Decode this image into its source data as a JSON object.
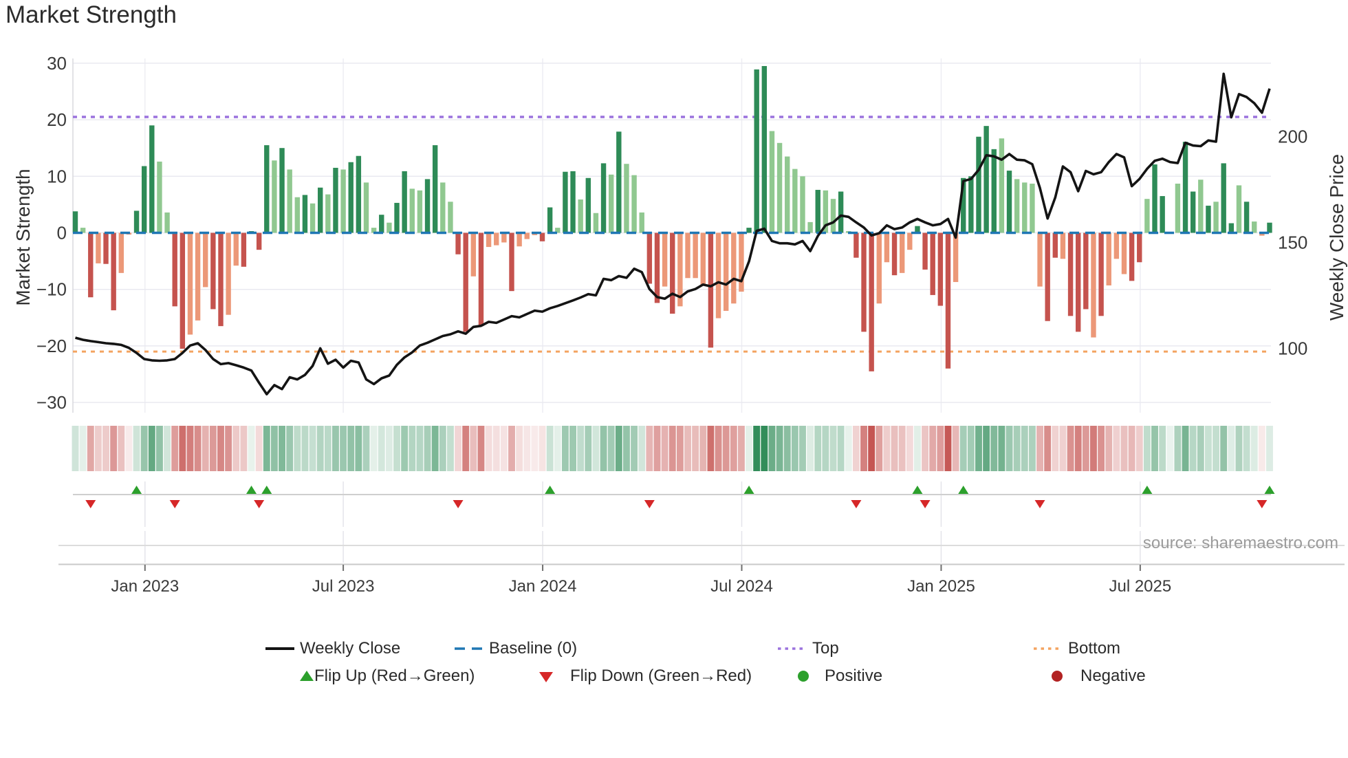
{
  "title": "Market Strength",
  "source": "source: sharemaestro.com",
  "axes": {
    "left": {
      "label": "Market Strength",
      "ticks": [
        30,
        20,
        10,
        0,
        -10,
        -20,
        -30
      ]
    },
    "right": {
      "label": "Weekly Close Price",
      "ticks": [
        200,
        150,
        100
      ]
    },
    "x": {
      "tick_labels": [
        "Jan 2023",
        "Jul 2023",
        "Jan 2024",
        "Jul 2024",
        "Jan 2025",
        "Jul 2025"
      ],
      "tick_week_index": [
        9.1,
        35.0,
        61.05,
        87.05,
        113.1,
        139.1
      ]
    }
  },
  "colors": {
    "dark_green": "#2e8b57",
    "light_green": "#90c890",
    "dark_red": "#c5534e",
    "light_red": "#ec9878",
    "baseline": "#1f77b4",
    "top": "#9b72dd",
    "bottom": "#f4a460",
    "line": "#141414",
    "flip_up": "#2ca02c",
    "flip_down": "#d62728",
    "positive": "#2ca02c",
    "negative": "#b22222",
    "grid": "#e9e9f0"
  },
  "legend": {
    "row1": [
      {
        "label": "Weekly Close",
        "swatch": "line",
        "color_key": "line"
      },
      {
        "label": "Baseline (0)",
        "swatch": "dash",
        "color_key": "baseline"
      },
      {
        "label": "Top",
        "swatch": "dot",
        "color_key": "top"
      },
      {
        "label": "Bottom",
        "swatch": "dot",
        "color_key": "bottom"
      }
    ],
    "row2": [
      {
        "label": "Flip Up (Red→Green)",
        "swatch": "tri-up",
        "color_key": "flip_up"
      },
      {
        "label": "Flip Down (Green→Red)",
        "swatch": "tri-down",
        "color_key": "flip_down"
      },
      {
        "label": "Positive",
        "swatch": "circle",
        "color_key": "positive"
      },
      {
        "label": "Negative",
        "swatch": "circle",
        "color_key": "negative"
      }
    ]
  },
  "chart_data": [
    {
      "type": "bar",
      "name": "market_strength_bars",
      "title": "Market Strength",
      "ylabel": "Market Strength",
      "ylim": [
        -33,
        31.5
      ],
      "n_weeks": 157,
      "baseline": 0,
      "top_line": 20.5,
      "bottom_line": -21,
      "grid": true,
      "values": [
        3.8,
        0.9,
        -11.4,
        -5.4,
        -5.5,
        -13.7,
        -7.1,
        -0.3,
        3.9,
        11.8,
        19.0,
        12.6,
        3.6,
        -13.0,
        -20.5,
        -18.0,
        -15.5,
        -9.6,
        -13.5,
        -16.5,
        -14.5,
        -5.8,
        -6.0,
        0.3,
        -3.0,
        15.5,
        12.8,
        15.0,
        11.2,
        6.3,
        6.7,
        5.2,
        8.0,
        6.8,
        11.5,
        11.2,
        12.5,
        13.6,
        8.9,
        0.9,
        3.2,
        1.8,
        5.3,
        10.9,
        7.8,
        7.5,
        9.5,
        15.5,
        8.9,
        5.5,
        -3.8,
        -17.5,
        -7.7,
        -16.5,
        -2.5,
        -2.2,
        -1.7,
        -10.3,
        -2.4,
        -1.1,
        -0.4,
        -1.5,
        4.5,
        0.9,
        10.8,
        10.9,
        5.9,
        9.7,
        3.5,
        12.3,
        10.3,
        17.9,
        12.2,
        10.2,
        3.6,
        -9.0,
        -12.4,
        -9.5,
        -14.3,
        -13.0,
        -8.0,
        -8.0,
        -9.3,
        -20.3,
        -15.1,
        -13.8,
        -12.5,
        -10.4,
        0.9,
        28.9,
        29.5,
        18.0,
        15.9,
        13.5,
        11.3,
        10.0,
        1.9,
        7.6,
        7.5,
        6.0,
        7.3,
        0.3,
        -4.4,
        -17.5,
        -24.5,
        -12.5,
        -5.2,
        -7.5,
        -7.1,
        -3.0,
        1.2,
        -6.5,
        -11.0,
        -12.9,
        -24.0,
        -8.7,
        9.7,
        10.0,
        17.0,
        18.9,
        14.8,
        16.7,
        11.0,
        9.5,
        8.9,
        8.7,
        -9.5,
        -15.6,
        -4.4,
        -4.6,
        -14.7,
        -17.5,
        -13.5,
        -18.5,
        -14.7,
        -9.3,
        -4.6,
        -7.3,
        -8.5,
        -5.2,
        6.0,
        12.1,
        6.5,
        0.0,
        8.7,
        16.1,
        7.3,
        9.4,
        4.8,
        5.5,
        12.3,
        1.7,
        8.4,
        5.5,
        2.0,
        -0.5,
        1.8
      ],
      "shades": "dldlddlldddllddlllddllddddldlldldldlddlldlddllddllddldllldlllddlddldldldlllddldlllldlllldddlllllldlldldddlldlldddddldddddldllllddldddldlllddlddllddldlddldlldd"
    },
    {
      "type": "line",
      "name": "weekly_close",
      "legend_label": "Weekly Close",
      "ylabel": "Weekly Close Price",
      "yticks": [
        100,
        150,
        200
      ],
      "n_weeks": 157,
      "values": [
        105.0,
        104.0,
        103.4,
        102.9,
        102.4,
        102.1,
        101.6,
        100.2,
        97.8,
        94.9,
        94.3,
        94.1,
        94.3,
        94.9,
        97.8,
        101.3,
        102.4,
        99.2,
        94.9,
        92.5,
        93.0,
        92.0,
        90.9,
        89.5,
        83.7,
        78.3,
        82.6,
        80.7,
        86.3,
        85.3,
        87.4,
        91.7,
        100.0,
        92.7,
        94.6,
        90.9,
        94.1,
        93.3,
        85.3,
        83.1,
        85.8,
        87.1,
        92.2,
        95.7,
        98.1,
        101.3,
        102.6,
        104.2,
        105.8,
        106.6,
        108.0,
        106.9,
        110.1,
        110.6,
        112.5,
        112.0,
        113.6,
        115.2,
        114.6,
        116.2,
        117.8,
        117.3,
        118.9,
        120.0,
        121.3,
        122.6,
        124.0,
        125.6,
        125.0,
        132.8,
        132.2,
        134.1,
        133.3,
        137.6,
        136.0,
        128.0,
        124.2,
        123.4,
        125.8,
        124.2,
        126.9,
        128.0,
        130.1,
        129.3,
        131.2,
        130.1,
        132.8,
        131.7,
        141.1,
        155.5,
        156.5,
        150.7,
        149.6,
        149.6,
        149.1,
        150.7,
        145.9,
        153.1,
        158.1,
        159.5,
        162.7,
        162.1,
        159.5,
        157.1,
        153.3,
        154.4,
        158.1,
        156.3,
        157.1,
        159.5,
        161.1,
        159.5,
        158.1,
        158.7,
        161.1,
        152.3,
        179.0,
        180.0,
        184.3,
        191.2,
        190.7,
        189.1,
        191.8,
        189.1,
        188.8,
        187.0,
        175.8,
        161.3,
        171.2,
        185.9,
        183.2,
        174.2,
        183.8,
        182.2,
        183.2,
        188.0,
        191.8,
        190.2,
        176.6,
        180.0,
        184.8,
        188.6,
        189.6,
        188.0,
        187.5,
        197.1,
        195.8,
        195.5,
        198.2,
        197.6,
        229.7,
        209.1,
        220.1,
        218.7,
        215.8,
        211.3,
        222.7
      ]
    },
    {
      "type": "heatmap",
      "name": "strength_heatmap",
      "note": "single-row strip; same weekly values as market_strength_bars, color intensity = |value|"
    },
    {
      "type": "scatter",
      "name": "flip_markers",
      "flip_up_weeks": [
        8,
        23,
        25,
        62,
        88,
        110,
        116,
        140,
        156
      ],
      "flip_down_weeks": [
        2,
        13,
        24,
        50,
        75,
        102,
        111,
        126,
        155
      ]
    }
  ]
}
